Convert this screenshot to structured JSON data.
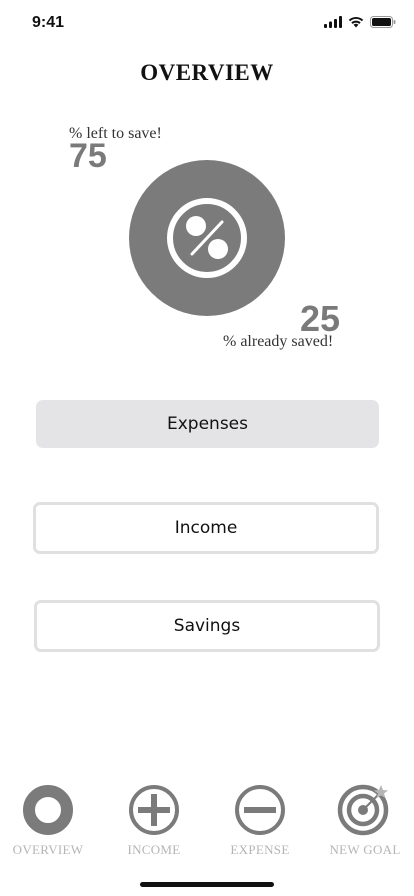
{
  "status_bar": {
    "time": "9:41"
  },
  "header": {
    "title": "OVERVIEW"
  },
  "progress": {
    "left_label": "% left to save!",
    "left_value": "75",
    "saved_value": "25",
    "saved_label": "% already saved!",
    "circle_color": "#7b7b7b",
    "value_color": "#7a7a7a",
    "icon": "percent-icon"
  },
  "buttons": {
    "expenses": "Expenses",
    "income": "Income",
    "savings": "Savings"
  },
  "tabs": [
    {
      "label": "OVERVIEW",
      "icon": "overview-icon"
    },
    {
      "label": "INCOME",
      "icon": "plus-circle-icon"
    },
    {
      "label": "EXPENSE",
      "icon": "minus-circle-icon"
    },
    {
      "label": "NEW GOAL",
      "icon": "target-icon"
    }
  ],
  "colors": {
    "button_fill": "#e4e4e6",
    "button_border": "#e0e0e0",
    "tab_icon": "#7b7b7b",
    "tab_label": "#b5b5b5"
  }
}
